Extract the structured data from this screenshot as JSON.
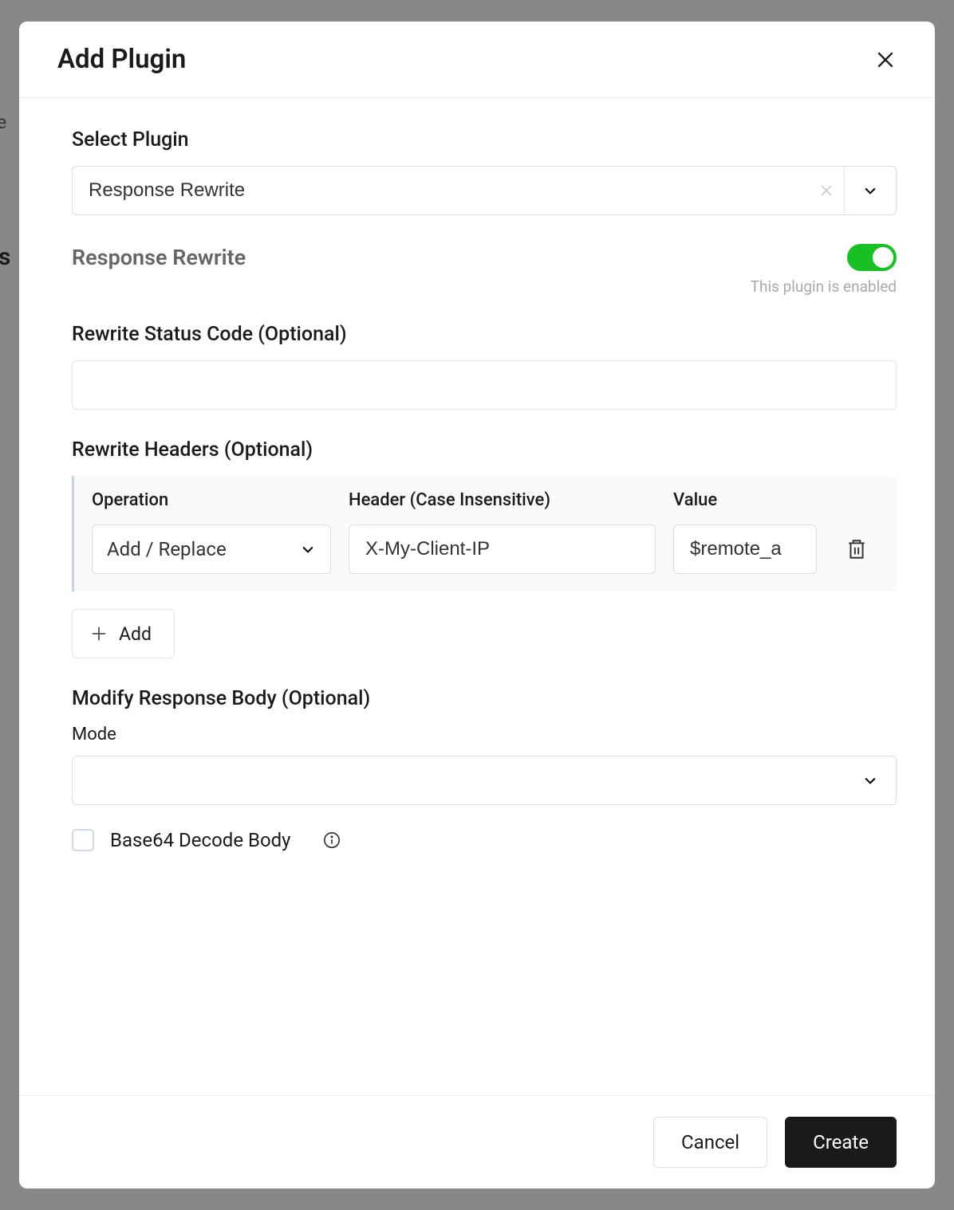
{
  "modal": {
    "title": "Add Plugin"
  },
  "select_plugin": {
    "label": "Select Plugin",
    "value": "Response Rewrite"
  },
  "plugin": {
    "title": "Response Rewrite",
    "enabled_hint": "This plugin is enabled"
  },
  "status_code": {
    "label": "Rewrite Status Code (Optional)",
    "value": ""
  },
  "headers": {
    "label": "Rewrite Headers (Optional)",
    "columns": {
      "operation": "Operation",
      "header": "Header (Case Insensitive)",
      "value": "Value"
    },
    "rows": [
      {
        "operation": "Add / Replace",
        "header": "X-My-Client-IP",
        "value": "$remote_a"
      }
    ],
    "add_label": "Add"
  },
  "body": {
    "label": "Modify Response Body (Optional)",
    "mode_label": "Mode",
    "mode_value": "",
    "base64_label": "Base64 Decode Body"
  },
  "footer": {
    "cancel": "Cancel",
    "create": "Create"
  },
  "background": {
    "left1": "e",
    "left2": "s"
  }
}
